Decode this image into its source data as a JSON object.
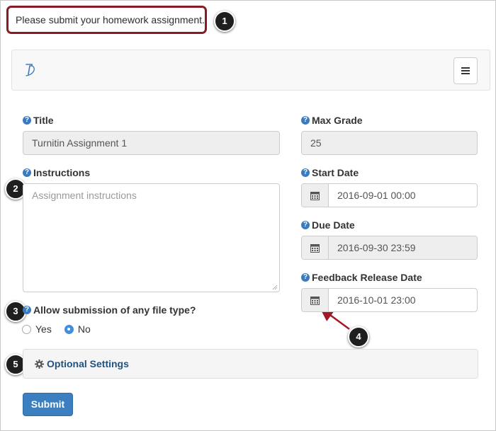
{
  "notice": {
    "text": "Please submit your homework assignment."
  },
  "callouts": [
    "1",
    "2",
    "3",
    "4",
    "5"
  ],
  "navbar": {
    "brand_icon": "turnitin-logo-icon",
    "menu_icon": "hamburger-menu-icon"
  },
  "form": {
    "title": {
      "label": "Title",
      "value": "Turnitin Assignment 1"
    },
    "max_grade": {
      "label": "Max Grade",
      "value": "25"
    },
    "instructions": {
      "label": "Instructions",
      "placeholder": "Assignment instructions"
    },
    "start_date": {
      "label": "Start Date",
      "value": "2016-09-01 00:00"
    },
    "due_date": {
      "label": "Due Date",
      "value": "2016-09-30 23:59"
    },
    "feedback_release_date": {
      "label": "Feedback Release Date",
      "value": "2016-10-01 23:00"
    },
    "allow_any_file": {
      "label": "Allow submission of any file type?",
      "options": [
        "Yes",
        "No"
      ],
      "selected": "No"
    },
    "optional_settings": {
      "label": "Optional Settings",
      "icon": "gear-icon"
    },
    "submit_label": "Submit"
  },
  "colors": {
    "notice_border": "#8a1b24",
    "primary": "#3b7fc0",
    "help_icon": "#3a7bbf",
    "annotation_arrow": "#a3182a"
  }
}
